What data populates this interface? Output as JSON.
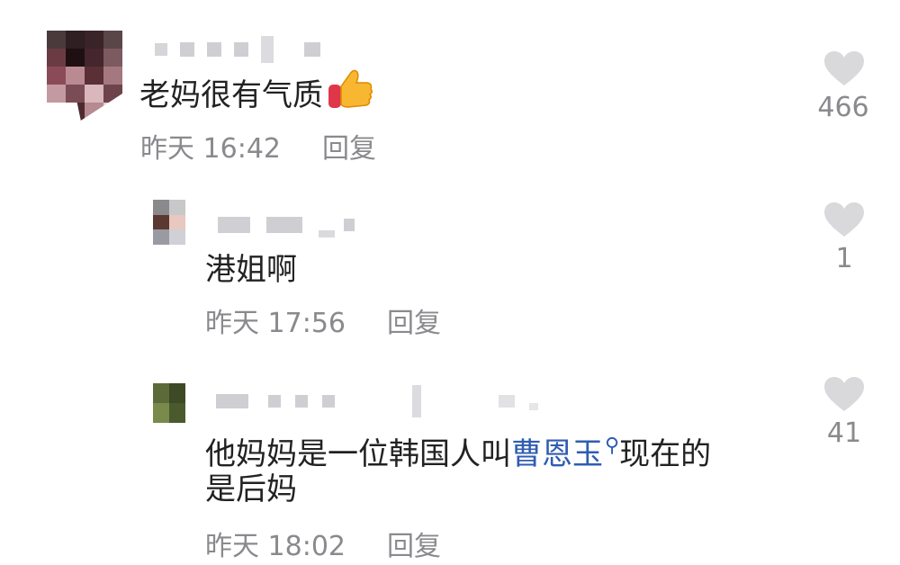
{
  "comments": [
    {
      "text": "老妈很有气质",
      "time": "昨天 16:42",
      "reply_label": "回复",
      "likes": "466",
      "emoji": "thumbs-up-icon"
    },
    {
      "text": "港姐啊",
      "time": "昨天 17:56",
      "reply_label": "回复",
      "likes": "1"
    },
    {
      "text_before": "他妈妈是一位韩国人叫",
      "link_text": "曹恩玉",
      "text_after": "现在的",
      "text_line2": "是后妈",
      "time": "昨天 18:02",
      "reply_label": "回复",
      "likes": "41"
    }
  ],
  "colors": {
    "text": "#222222",
    "meta": "#8a8a8e",
    "link": "#2f5db2",
    "heart": "#d9d9dc"
  }
}
